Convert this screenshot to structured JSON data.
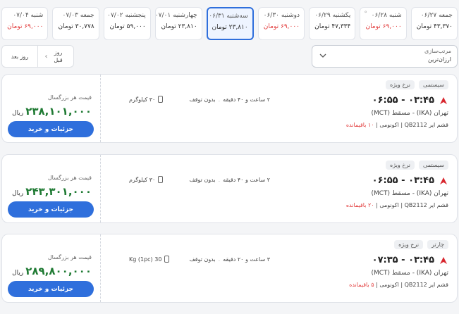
{
  "dates": [
    {
      "label": "جمعه ۰۶/۲۷",
      "price": "۴۳,۳۷۰ تومان",
      "red": false,
      "active": false,
      "mark": ""
    },
    {
      "label": "شنبه ۰۶/۲۸",
      "price": "۶۹,۰۰۰ تومان",
      "red": true,
      "active": false,
      "mark": "°"
    },
    {
      "label": "یکشنبه ۰۶/۲۹",
      "price": "۴۷,۳۳۴ تومان",
      "red": false,
      "active": false,
      "mark": ""
    },
    {
      "label": "دوشنبه ۰۶/۳۰",
      "price": "۶۹,۰۰۰ تومان",
      "red": true,
      "active": false,
      "mark": ""
    },
    {
      "label": "سه‌شنبه ۰۶/۳۱",
      "price": "۲۳,۸۱۰ تومان",
      "red": false,
      "active": true,
      "mark": ""
    },
    {
      "label": "چهارشنبه ۰۷/۰۱",
      "price": "۲۳,۸۱۰ تومان",
      "red": false,
      "active": false,
      "mark": ""
    },
    {
      "label": "پنجشنبه ۰۷/۰۲",
      "price": "۵۹,۰۰۰ تومان",
      "red": false,
      "active": false,
      "mark": ""
    },
    {
      "label": "جمعه ۰۷/۰۳",
      "price": "۳۰,۷۷۸ تومان",
      "red": false,
      "active": false,
      "mark": ""
    },
    {
      "label": "شنبه ۰۷/۰۴",
      "price": "۶۹,۰۰۰ تومان",
      "red": true,
      "active": false,
      "mark": ""
    }
  ],
  "sort": {
    "label": "مرتب‌سازی",
    "value": "ارزان‌ترین"
  },
  "nav": {
    "prev": "روز قبل",
    "next": "روز بعد"
  },
  "colors": {
    "accent": "#2f6fdc",
    "price": "#1f7a33",
    "warn": "#e23b3b"
  },
  "flights": [
    {
      "tags": [
        "سیستمی",
        "نرخ ویژه"
      ],
      "times": "۰۳:۴۵ - ۰۶:۵۵",
      "route": "تهران (IKA) - مسقط (MCT)",
      "flight_info": "قشم ایر QB2112 | اکونومی | ",
      "seats": "۱۰ باقیمانده",
      "duration": "۲ ساعت و ۴۰ دقیقه",
      "stops": "بدون توقف",
      "baggage": "۳۰ کیلوگرم",
      "price_caption": "قیمت هر بزرگسال",
      "price": "۲۳۸,۱۰۱,۰۰۰",
      "currency": "ریال",
      "buy": "جزئیات و خرید"
    },
    {
      "tags": [
        "سیستمی",
        "نرخ ویژه"
      ],
      "times": "۰۳:۴۵ - ۰۶:۵۵",
      "route": "تهران (IKA) - مسقط (MCT)",
      "flight_info": "قشم ایر QB2112 | اکونومی | ",
      "seats": "۲۰ باقیمانده",
      "duration": "۲ ساعت و ۴۰ دقیقه",
      "stops": "بدون توقف",
      "baggage": "۳۰ کیلوگرم",
      "price_caption": "قیمت هر بزرگسال",
      "price": "۲۴۳,۳۰۱,۰۰۰",
      "currency": "ریال",
      "buy": "جزئیات و خرید"
    },
    {
      "tags": [
        "چارتر",
        "نرخ ویژه"
      ],
      "times": "۰۳:۴۵ - ۰۷:۳۵",
      "route": "تهران (IKA) - مسقط (MCT)",
      "flight_info": "قشم ایر QB2112 | اکونومی | ",
      "seats": "۵ باقیمانده",
      "duration": "۳ ساعت و ۲۰ دقیقه",
      "stops": "بدون توقف",
      "baggage": "30 Kg (1pc)",
      "price_caption": "قیمت هر بزرگسال",
      "price": "۲۸۹,۸۰۰,۰۰۰",
      "currency": "ریال",
      "buy": "جزئیات و خرید"
    }
  ]
}
